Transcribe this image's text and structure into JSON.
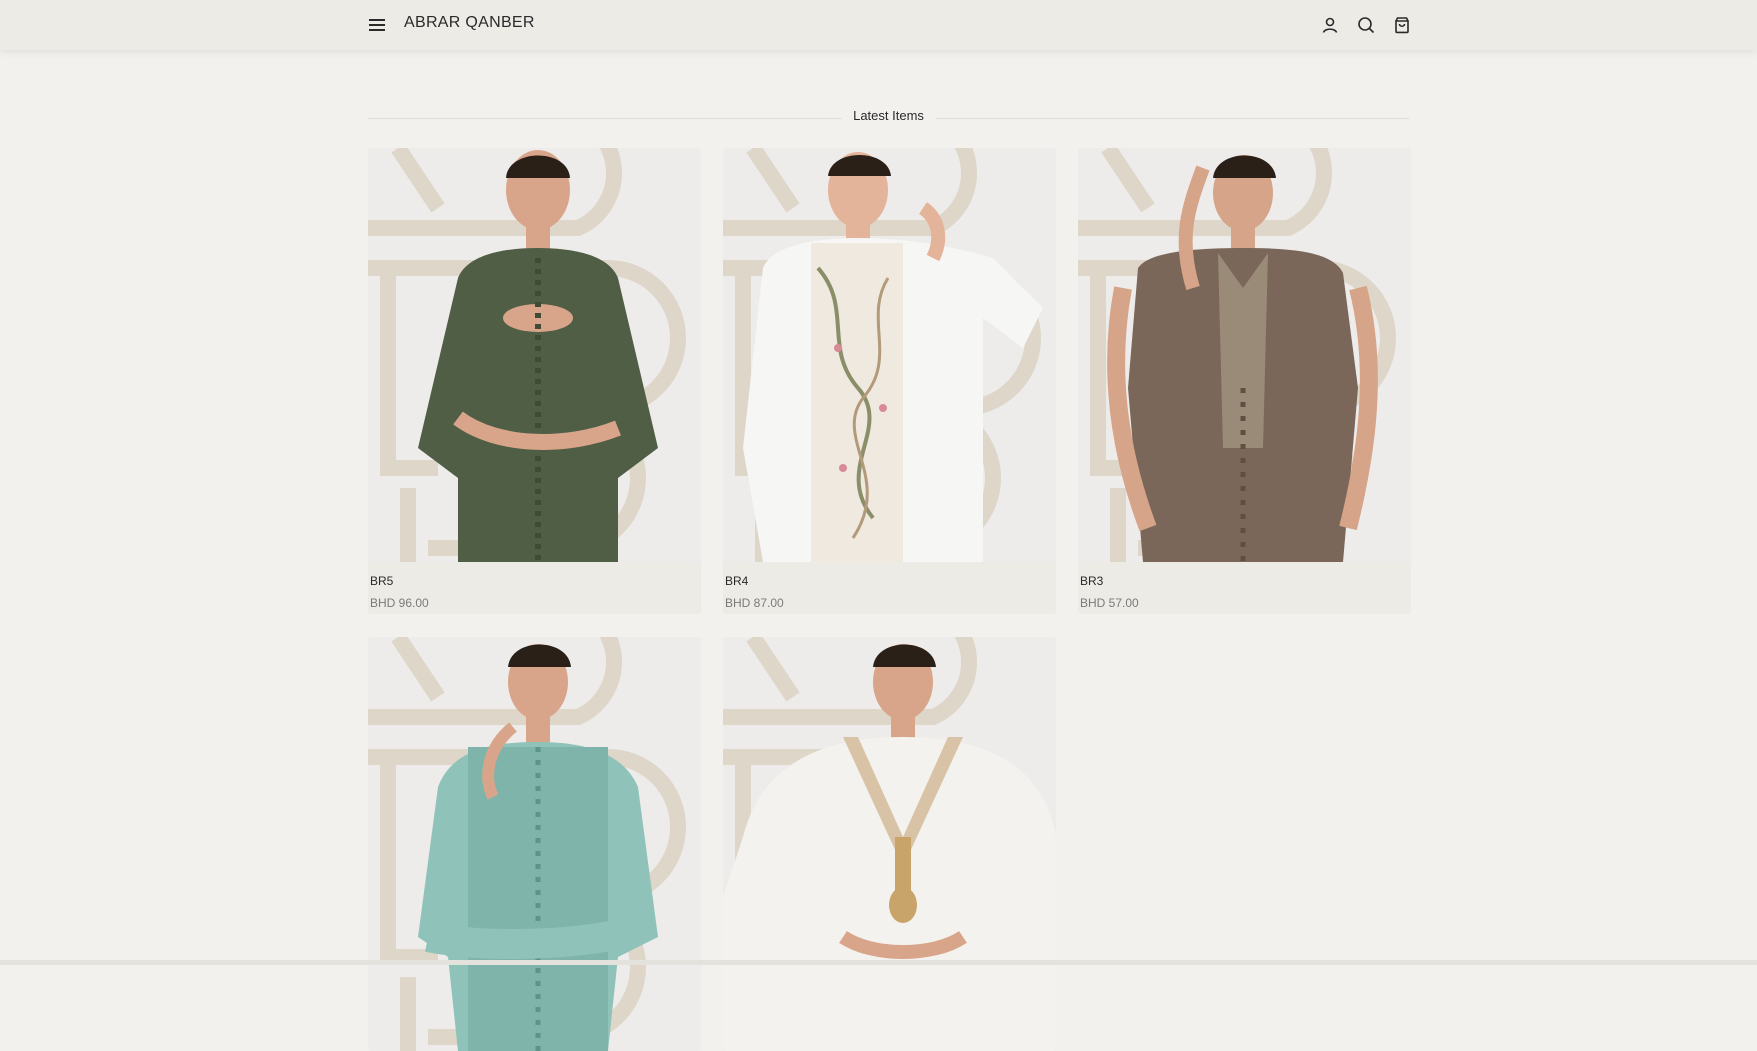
{
  "header": {
    "brand": "ABRAR QANBER",
    "icons": [
      "menu-icon",
      "account-icon",
      "search-icon",
      "cart-icon"
    ]
  },
  "section": {
    "title": "Latest Items"
  },
  "products": [
    {
      "name": "BR5",
      "price": "BHD 96.00",
      "garment_color": "#4f5e45"
    },
    {
      "name": "BR4",
      "price": "BHD 87.00",
      "garment_color": "#f6f6f4"
    },
    {
      "name": "BR3",
      "price": "BHD 57.00",
      "garment_color": "#7b6759"
    },
    {
      "name": "",
      "price": "",
      "garment_color": "#8fc3b9"
    },
    {
      "name": "",
      "price": "",
      "garment_color": "#f4f2ee"
    }
  ],
  "colors": {
    "page_bg": "#f2f1ed",
    "header_bg": "#edebe6",
    "card_bg": "#ecebe6",
    "watermark": "#ddd6c9",
    "price_text": "#7a7a7a"
  }
}
